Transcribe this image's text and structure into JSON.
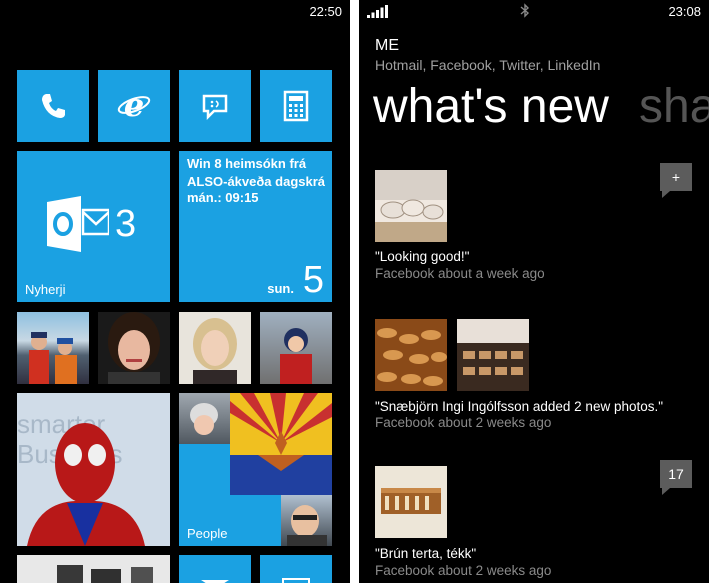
{
  "left_phone": {
    "time": "22:50",
    "tiles": {
      "outlook_count": "3",
      "outlook_label": "Nyherji",
      "calendar_event": "Win 8 heimsókn frá ALSO-ákveða dagskrá",
      "calendar_time": "mán.: 09:15",
      "calendar_day": "sun.",
      "calendar_date": "5",
      "people_label": "People"
    }
  },
  "right_phone": {
    "time": "23:08",
    "header_title": "ME",
    "header_subtitle": "Hotmail, Facebook, Twitter, LinkedIn",
    "pivot_active": "what's new",
    "pivot_next": "sha",
    "feed": [
      {
        "caption": "\"Looking good!\"",
        "meta": "Facebook about a week ago",
        "badge": "+"
      },
      {
        "caption": "\"Snæbjörn Ingi Ingólfsson added 2 new photos.\"",
        "meta": "Facebook about 2 weeks ago",
        "badge": ""
      },
      {
        "caption": "\"Brún terta, tékk\"",
        "meta": "Facebook about 2 weeks ago",
        "badge": "17"
      }
    ]
  },
  "colors": {
    "accent": "#1ba1e2",
    "background": "#000000",
    "secondary_text": "#8a8a8a",
    "badge": "#5c5c5c"
  }
}
